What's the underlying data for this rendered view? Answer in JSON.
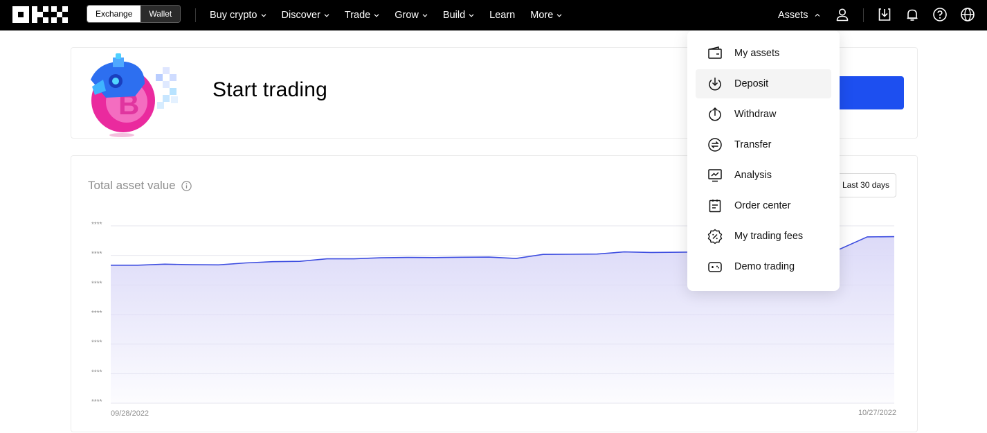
{
  "topnav": {
    "segment": {
      "exchange": "Exchange",
      "wallet": "Wallet"
    },
    "items": [
      {
        "label": "Buy crypto",
        "dropdown": true
      },
      {
        "label": "Discover",
        "dropdown": true
      },
      {
        "label": "Trade",
        "dropdown": true
      },
      {
        "label": "Grow",
        "dropdown": true
      },
      {
        "label": "Build",
        "dropdown": true
      },
      {
        "label": "Learn",
        "dropdown": false
      },
      {
        "label": "More",
        "dropdown": true
      }
    ],
    "assets_label": "Assets",
    "right_icons": [
      "user-icon",
      "download-app-icon",
      "bell-icon",
      "help-icon",
      "globe-icon"
    ]
  },
  "hero": {
    "title": "Start trading",
    "cta_color": "#1d4ff0"
  },
  "asset_card": {
    "title": "Total asset value",
    "range_label": "Last 30 days"
  },
  "assets_menu": {
    "items": [
      {
        "label": "My assets",
        "icon": "wallet-icon"
      },
      {
        "label": "Deposit",
        "icon": "deposit-icon"
      },
      {
        "label": "Withdraw",
        "icon": "withdraw-icon"
      },
      {
        "label": "Transfer",
        "icon": "transfer-icon"
      },
      {
        "label": "Analysis",
        "icon": "analysis-icon"
      },
      {
        "label": "Order center",
        "icon": "order-center-icon"
      },
      {
        "label": "My trading fees",
        "icon": "fee-icon"
      },
      {
        "label": "Demo trading",
        "icon": "demo-trading-icon"
      }
    ]
  },
  "chart_data": {
    "type": "area",
    "title": "",
    "x_labels": [
      "09/28/2022",
      "10/27/2022"
    ],
    "y_tick_labels": [
      "****",
      "****",
      "****",
      "****",
      "****",
      "****",
      "****"
    ],
    "values": [
      0.778,
      0.778,
      0.784,
      0.781,
      0.78,
      0.791,
      0.798,
      0.8,
      0.814,
      0.814,
      0.82,
      0.822,
      0.821,
      0.823,
      0.824,
      0.816,
      0.839,
      0.84,
      0.841,
      0.853,
      0.85,
      0.851,
      0.853,
      0.854,
      0.856,
      0.86,
      0.863,
      0.87,
      0.938,
      0.939
    ],
    "y_scale": "hidden (values masked)",
    "line_color": "#3d4de0",
    "fill_color": "#dcdaf8",
    "grid": true
  }
}
